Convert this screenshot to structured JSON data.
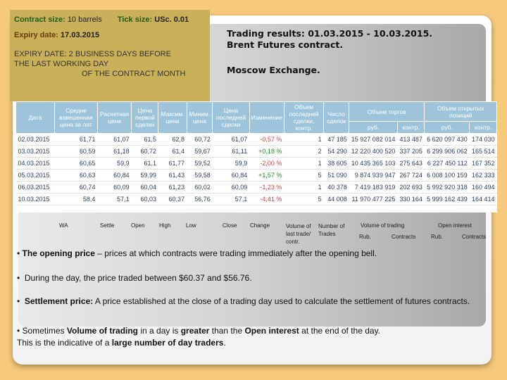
{
  "info": {
    "contract_size_label": "Contract size:",
    "contract_size_value": "10 barrels",
    "tick_size_label": "Tick size:",
    "tick_size_value": "USc. 0.01",
    "expiry_label": "Expiry date:",
    "expiry_value": "17.03.2015",
    "note_line1": "EXPIRY DATE: 2 BUSINESS DAYS BEFORE",
    "note_line2": "THE LAST WORKING DAY",
    "note_line3": "OF THE CONTRACT MONTH"
  },
  "title_line1": "Trading results: 01.03.2015 - 10.03.2015.",
  "title_line2": "Brent Futures contract.",
  "subtitle": "Moscow Exchange.",
  "table": {
    "headers": {
      "date": "Дата",
      "wa": "Средне взвешенная цена за лот",
      "settle": "Расчетная цена",
      "open": "Цена первой сделки",
      "high": "Максим. цена",
      "low": "Миним. цена",
      "close": "Цена последней сделки",
      "change": "Изменение",
      "last_vol": "Объем последней сделки, контр.",
      "trades": "Число сделок",
      "volume_group": "Объем торгов",
      "oi_group": "Объем открытых позиций",
      "rub": "руб.",
      "contracts": "контр."
    },
    "rows": [
      {
        "date": "02.03.2015",
        "wa": "61,71",
        "settle": "61,07",
        "open": "61,5",
        "high": "62,8",
        "low": "60,72",
        "close": "61,07",
        "change": "-0,57 %",
        "last_vol": "1",
        "trades": "47 185",
        "vol_rub": "15 927 082 014",
        "vol_contracts": "413 487",
        "oi_rub": "6 620 097 430",
        "oi_contracts": "174 030",
        "dir": "neg"
      },
      {
        "date": "03.03.2015",
        "wa": "60,59",
        "settle": "61,18",
        "open": "60,72",
        "high": "61,4",
        "low": "59,67",
        "close": "61,11",
        "change": "+0,18 %",
        "last_vol": "2",
        "trades": "54 290",
        "vol_rub": "12 220 400 520",
        "vol_contracts": "337 205",
        "oi_rub": "6 299 906 062",
        "oi_contracts": "165 514",
        "dir": "pos"
      },
      {
        "date": "04.03.2015",
        "wa": "60,65",
        "settle": "59,9",
        "open": "61,1",
        "high": "61,77",
        "low": "59,52",
        "close": "59,9",
        "change": "-2,00 %",
        "last_vol": "1",
        "trades": "38 605",
        "vol_rub": "10 435 365 103",
        "vol_contracts": "275 643",
        "oi_rub": "6 227 450 112",
        "oi_contracts": "167 352",
        "dir": "neg"
      },
      {
        "date": "05.03.2015",
        "wa": "60,63",
        "settle": "60,84",
        "open": "59,99",
        "high": "61,43",
        "low": "59,58",
        "close": "60,84",
        "change": "+1,57 %",
        "last_vol": "5",
        "trades": "51 090",
        "vol_rub": "9 874 939 947",
        "vol_contracts": "267 724",
        "oi_rub": "6 008 100 159",
        "oi_contracts": "162 333",
        "dir": "pos"
      },
      {
        "date": "06.03.2015",
        "wa": "60,74",
        "settle": "60,09",
        "open": "60,04",
        "high": "61,23",
        "low": "60,02",
        "close": "60,09",
        "change": "-1,23 %",
        "last_vol": "1",
        "trades": "40 378",
        "vol_rub": "7 419 183 919",
        "vol_contracts": "202 693",
        "oi_rub": "5 992 920 318",
        "oi_contracts": "160 494",
        "dir": "neg"
      },
      {
        "date": "10.03.2015",
        "wa": "58,4",
        "settle": "57,1",
        "open": "60,03",
        "high": "60,37",
        "low": "56,76",
        "close": "57,1",
        "change": "-4,41 %",
        "last_vol": "5",
        "trades": "44 008",
        "vol_rub": "11 970 477 225",
        "vol_contracts": "330 164",
        "oi_rub": "5 999 162 439",
        "oi_contracts": "164 414",
        "dir": "neg"
      }
    ]
  },
  "legend": {
    "wa": "WA",
    "settle": "Settle",
    "open": "Open",
    "high": "High",
    "low": "Low",
    "close": "Close",
    "change": "Change",
    "last_vol_1": "Volume of",
    "last_vol_2": "last trade/",
    "last_vol_3": "contr.",
    "trades_1": "Number of",
    "trades_2": "Trades",
    "vot": "Volume of trading",
    "oi": "Open interest",
    "rub1": "Rub.",
    "contracts1": "Contracts",
    "rub2": "Rub.",
    "contracts2": "Contracts"
  },
  "bullets": {
    "b1_bold": "The opening price",
    "b1_text": " – prices at which contracts were trading immediately after the opening bell.",
    "b2_text": "During the day, the price traded between $60.37 and $56.76.",
    "b3_bold": "Settlement price:",
    "b3_text": " A price established at the close of a trading day used to calculate the settlement of futures contracts.",
    "b4_pre": "Sometimes ",
    "b4_bold1": "Volume of trading",
    "b4_mid1": " in a day is ",
    "b4_bold2": "greater",
    "b4_mid2": " than the ",
    "b4_bold3": "Open interest",
    "b4_post": " at the end of the day.",
    "b5_pre": "This is the indicative of a ",
    "b5_bold": "large number of day traders",
    "b5_post": "."
  }
}
